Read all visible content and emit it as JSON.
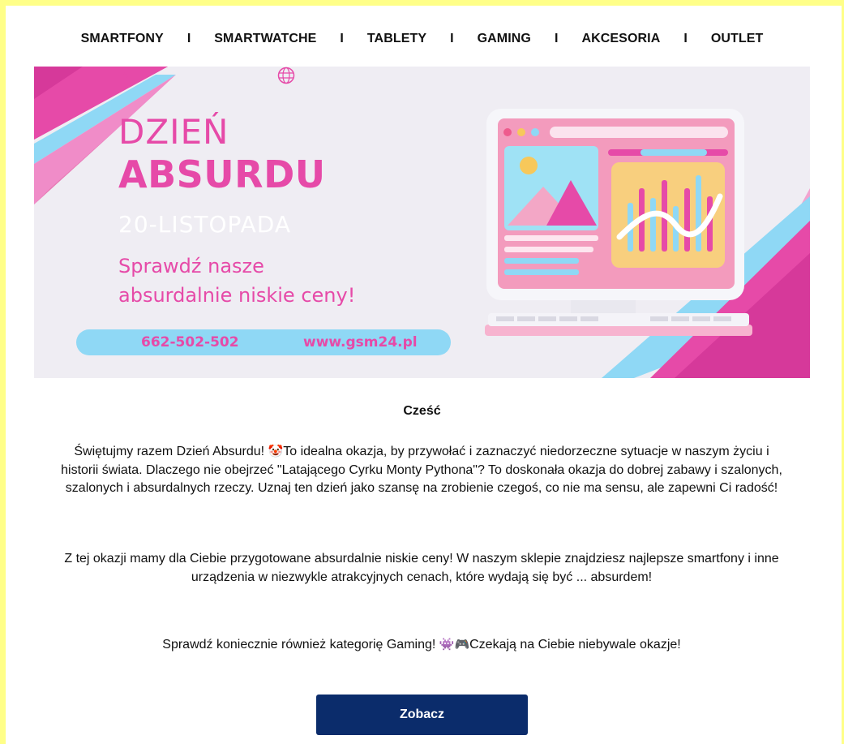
{
  "nav": {
    "items": [
      "SMARTFONY",
      "SMARTWATCHE",
      "TABLETY",
      "GAMING",
      "AKCESORIA",
      "OUTLET"
    ],
    "separator": "I"
  },
  "banner": {
    "title_line1": "DZIEŃ",
    "title_line2": "ABSURDU",
    "date": "20-LISTOPADA",
    "subtitle_line1": "Sprawdź nasze",
    "subtitle_line2": "absurdalnie niskie ceny!",
    "phone": "662-502-502",
    "website": "www.gsm24.pl",
    "colors": {
      "pink": "#e64aa8",
      "light_blue": "#8fd8f5",
      "background": "#efedf3"
    }
  },
  "content": {
    "greeting": "Cześć",
    "p1_before_emoji": "Świętujmy razem Dzień Absurdu! ",
    "p1_emoji": "🤡",
    "p1_after_emoji": "To idealna okazja, by przywołać i zaznaczyć niedorzeczne sytuacje w naszym życiu i historii świata. Dlaczego nie obejrzeć \"Latającego Cyrku Monty Pythona\"? To doskonała okazja do dobrej zabawy i szalonych, szalonych i absurdalnych rzeczy. Uznaj ten dzień jako szansę na zrobienie czegoś, co nie ma sensu, ale zapewni Ci radość!",
    "p2": "Z tej okazji mamy dla Ciebie przygotowane absurdalnie niskie ceny! W naszym sklepie znajdziesz najlepsze smartfony i inne urządzenia w niezwykle atrakcyjnych cenach, które wydają się być ... absurdem!",
    "p3_before_emoji": "Sprawdź koniecznie również kategorię Gaming! ",
    "p3_emoji": "👾🎮",
    "p3_after_emoji": "Czekają na Ciebie niebywale okazje!",
    "cta_label": "Zobacz",
    "cta_color": "#0b2c6b"
  },
  "frame_color": "#ffff88"
}
